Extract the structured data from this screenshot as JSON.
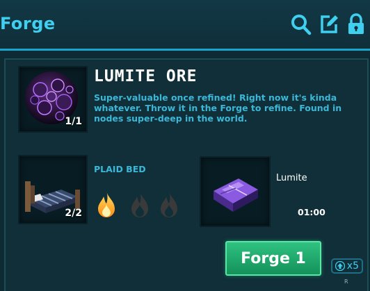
{
  "header": {
    "title": "Forge",
    "icons": [
      "search-icon",
      "edit-icon",
      "lock-icon"
    ]
  },
  "item": {
    "name": "LUMITE ORE",
    "description": "Super-valuable once refined! Right now it's kinda whatever. Throw it in the Forge to refine. Found in nodes super-deep in the world.",
    "count": "1/1"
  },
  "fuel": {
    "name": "PLAID BED",
    "count": "2/2",
    "flames_total": 3,
    "flames_lit": 1
  },
  "output": {
    "name": "Lumite",
    "time": "01:00"
  },
  "actions": {
    "forge_label": "Forge 1",
    "multiplier_label": "x5",
    "multiplier_hotkey": "R"
  },
  "colors": {
    "accent": "#3fd0f0",
    "button": "#1fa86b",
    "flame_lit": "#ffb020",
    "flame_unlit": "#3a3a3a"
  }
}
